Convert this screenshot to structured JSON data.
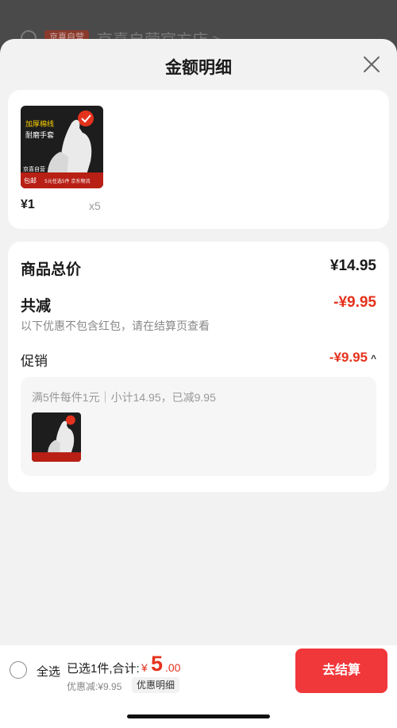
{
  "background": {
    "store_tag": "京喜自营",
    "store_name": "京喜自营官方店 >"
  },
  "sheet": {
    "title": "金额明细"
  },
  "product": {
    "image_text_1": "加厚棉线",
    "image_text_2": "耐磨手套",
    "image_badge_1": "京喜自营",
    "image_badge_2": "包邮",
    "image_footer": "5元任选5件 京东物流",
    "price": "¥1",
    "quantity": "x5"
  },
  "summary": {
    "total_label": "商品总价",
    "total_value": "¥14.95",
    "reduce_label": "共减",
    "reduce_value": "-¥9.95",
    "note": "以下优惠不包含红包，请在结算页查看",
    "promo_label": "促销",
    "promo_value": "-¥9.95",
    "promo_desc": "满5件每件1元｜小计14.95，已减9.95"
  },
  "bottom": {
    "select_all": "全选",
    "selected_text": "已选1件,合计:",
    "currency": "¥",
    "total_int": "5",
    "total_dec": ".00",
    "discount": "优惠减:¥9.95",
    "detail_button": "优惠明细",
    "checkout_button": "去结算"
  },
  "colors": {
    "accent": "#e5321d",
    "checkout": "#f0373a"
  }
}
